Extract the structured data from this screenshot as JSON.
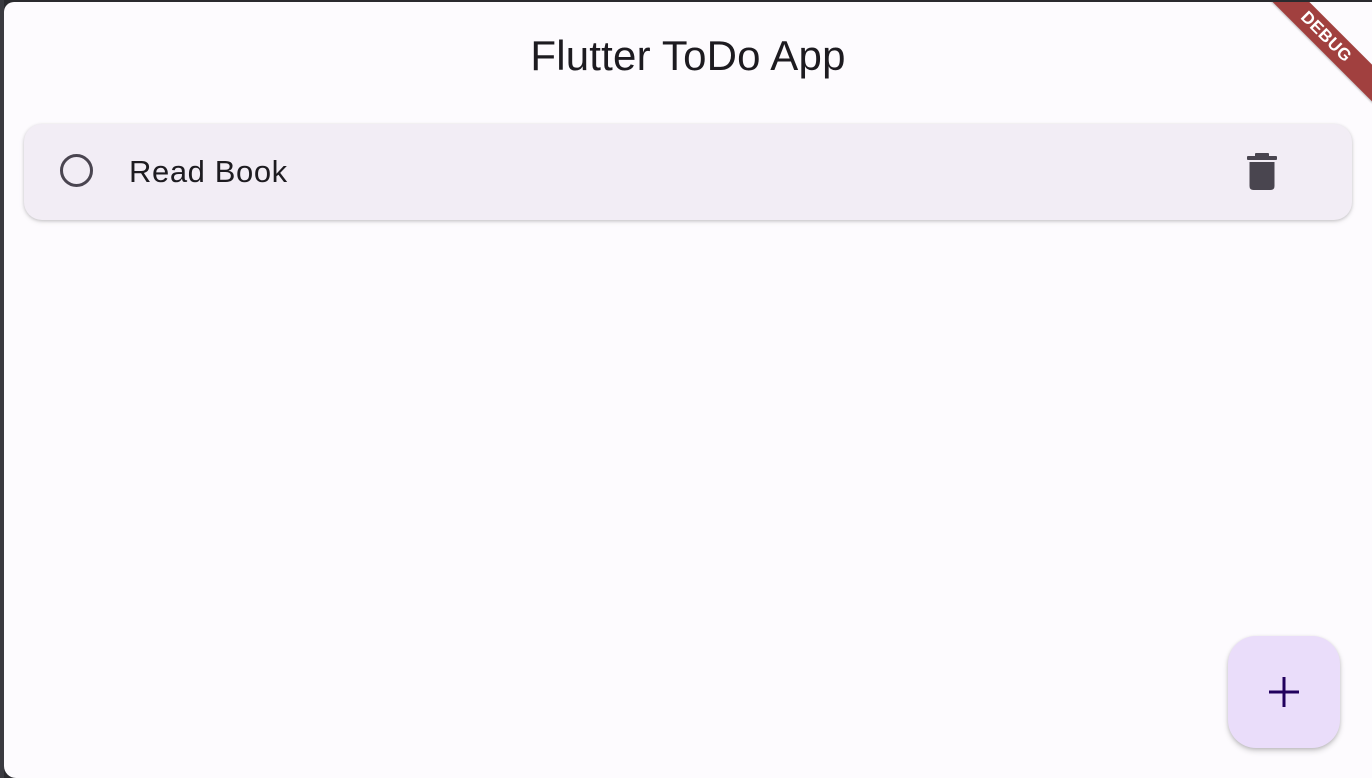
{
  "app": {
    "title": "Flutter ToDo App",
    "debug_label": "DEBUG"
  },
  "todos": [
    {
      "text": "Read Book",
      "completed": false,
      "check_icon": "circle-outline-icon",
      "delete_icon": "trash-icon"
    }
  ],
  "fab": {
    "icon": "plus-icon"
  },
  "colors": {
    "background": "#fdfbfe",
    "card": "#f2edf5",
    "fab": "#eaddfa",
    "fab_icon": "#21005d",
    "icon": "#49454f",
    "debug_banner": "#a1403f"
  }
}
